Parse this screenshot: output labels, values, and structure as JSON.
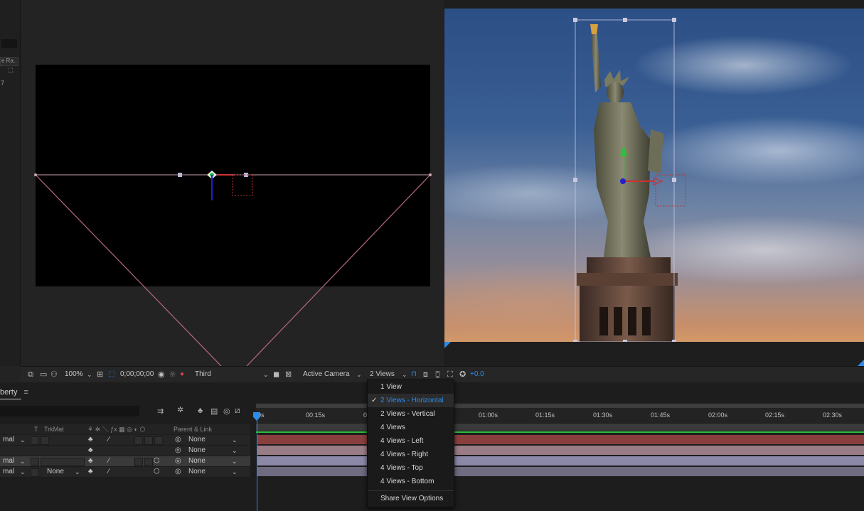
{
  "left_strip": {
    "label": "e Ra..",
    "number": "7"
  },
  "viewer_toolbar": {
    "zoom": "100%",
    "timecode": "0;00;00;00",
    "resolution": "Third",
    "view": "Active Camera",
    "layout": "2 Views",
    "exposure": "+0.0"
  },
  "timeline": {
    "panel_tab": "berty",
    "header": {
      "t": "T",
      "trkmat": "TrkMat",
      "parent": "Parent & Link"
    },
    "rows": [
      {
        "mode": "mal",
        "trkmat": "",
        "parent": "None"
      },
      {
        "mode": "",
        "trkmat": "",
        "parent": "None"
      },
      {
        "mode": "mal",
        "trkmat": "",
        "parent": "None"
      },
      {
        "mode": "mal",
        "trkmat": "None",
        "parent": "None"
      }
    ],
    "ruler": [
      "0s",
      "00:15s",
      "0",
      "01:00s",
      "01:15s",
      "01:30s",
      "01:45s",
      "02:00s",
      "02:15s",
      "02:30s"
    ]
  },
  "menu": {
    "items": [
      {
        "label": "1 View",
        "checked": false
      },
      {
        "label": "2 Views - Horizontal",
        "checked": true
      },
      {
        "label": "2 Views - Vertical",
        "checked": false
      },
      {
        "label": "4 Views",
        "checked": false
      },
      {
        "label": "4 Views - Left",
        "checked": false
      },
      {
        "label": "4 Views - Right",
        "checked": false
      },
      {
        "label": "4 Views - Top",
        "checked": false
      },
      {
        "label": "4 Views - Bottom",
        "checked": false
      }
    ],
    "options": "Share View Options"
  },
  "colors": {
    "accent": "#2d8ceb",
    "track_red": "#8a3f3f",
    "track_pink": "#9a7c86",
    "track_lavender": "#8c89a8",
    "track_grey": "#6f6b80"
  }
}
